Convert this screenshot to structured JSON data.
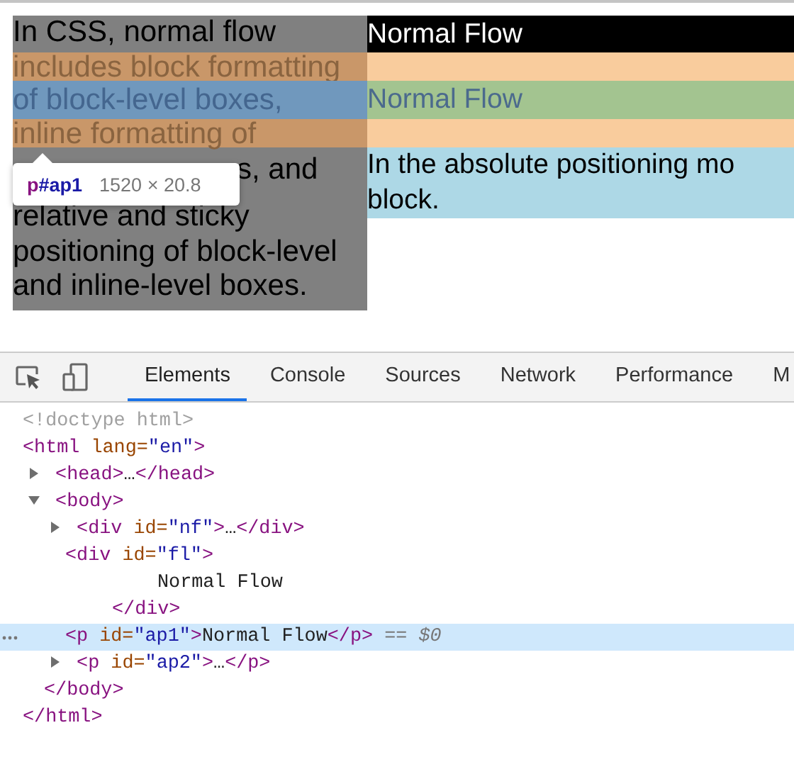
{
  "page": {
    "left_paragraph": {
      "lines": [
        {
          "text": "In CSS, normal flow",
          "kind": "plain"
        },
        {
          "text": "includes block formatting",
          "kind": "margin"
        },
        {
          "text": "of block-level boxes,",
          "kind": "content"
        },
        {
          "text": "inline formatting of",
          "kind": "margin"
        },
        {
          "text": "s, and",
          "kind": "partial"
        },
        {
          "text": "relative and sticky",
          "kind": "plain"
        },
        {
          "text": "positioning of block-level",
          "kind": "plain"
        },
        {
          "text": "and inline-level boxes.",
          "kind": "plain"
        }
      ]
    },
    "heading": "Normal Flow",
    "highlighted_text": "Normal Flow",
    "blue_paragraph": {
      "lines": [
        "In the absolute positioning mo",
        "block."
      ]
    },
    "tooltip": {
      "tag": "p",
      "id": "#ap1",
      "size": "1520 × 20.8"
    }
  },
  "devtools": {
    "tabs": [
      {
        "label": "Elements",
        "selected": true
      },
      {
        "label": "Console",
        "selected": false
      },
      {
        "label": "Sources",
        "selected": false
      },
      {
        "label": "Network",
        "selected": false
      },
      {
        "label": "Performance",
        "selected": false
      },
      {
        "label": "M",
        "selected": false
      }
    ],
    "tree": [
      {
        "kind": "doctype",
        "selected": false,
        "text": "<!doctype html>"
      },
      {
        "kind": "element",
        "selected": false,
        "open": [
          {
            "t": "<html",
            "kind": "tag"
          },
          {
            "t": " lang=",
            "kind": "attr"
          },
          {
            "t": "\"en\"",
            "kind": "value"
          },
          {
            "t": ">",
            "kind": "tag"
          }
        ],
        "children": [
          {
            "kind": "element",
            "selected": false,
            "expanded": false,
            "open": [
              {
                "t": "<head>",
                "kind": "tag"
              },
              {
                "t": "…",
                "kind": "text"
              },
              {
                "t": "</head>",
                "kind": "tag"
              }
            ]
          },
          {
            "kind": "element",
            "selected": false,
            "expanded": true,
            "open": [
              {
                "t": "<body>",
                "kind": "tag"
              }
            ],
            "children": [
              {
                "kind": "element",
                "selected": false,
                "expanded": false,
                "open": [
                  {
                    "t": "<div",
                    "kind": "tag"
                  },
                  {
                    "t": " id=",
                    "kind": "attr"
                  },
                  {
                    "t": "\"nf\"",
                    "kind": "value"
                  },
                  {
                    "t": ">",
                    "kind": "tag"
                  },
                  {
                    "t": "…",
                    "kind": "text"
                  },
                  {
                    "t": "</div>",
                    "kind": "tag"
                  }
                ]
              },
              {
                "kind": "element",
                "selected": false,
                "open": [
                  {
                    "t": "<div",
                    "kind": "tag"
                  },
                  {
                    "t": " id=",
                    "kind": "attr"
                  },
                  {
                    "t": "\"fl\"",
                    "kind": "value"
                  },
                  {
                    "t": ">",
                    "kind": "tag"
                  }
                ],
                "children": [
                  {
                    "kind": "text",
                    "selected": false,
                    "open": [
                      {
                        "t": "Normal Flow",
                        "kind": "text"
                      }
                    ]
                  }
                ],
                "close": [
                  {
                    "t": "</div>",
                    "kind": "tag"
                  }
                ]
              },
              {
                "kind": "element",
                "selected": true,
                "open": [
                  {
                    "t": "<p",
                    "kind": "tag"
                  },
                  {
                    "t": " id=",
                    "kind": "attr"
                  },
                  {
                    "t": "\"ap1\"",
                    "kind": "value"
                  },
                  {
                    "t": ">",
                    "kind": "tag"
                  },
                  {
                    "t": "Normal Flow",
                    "kind": "text"
                  },
                  {
                    "t": "</p>",
                    "kind": "tag"
                  },
                  {
                    "t": " == ",
                    "kind": "ref"
                  },
                  {
                    "t": "$0",
                    "kind": "ref"
                  }
                ]
              },
              {
                "kind": "element",
                "selected": false,
                "expanded": false,
                "open": [
                  {
                    "t": "<p",
                    "kind": "tag"
                  },
                  {
                    "t": " id=",
                    "kind": "attr"
                  },
                  {
                    "t": "\"ap2\"",
                    "kind": "value"
                  },
                  {
                    "t": ">",
                    "kind": "tag"
                  },
                  {
                    "t": "…",
                    "kind": "text"
                  },
                  {
                    "t": "</p>",
                    "kind": "tag"
                  }
                ]
              }
            ],
            "close": [
              {
                "t": "</body>",
                "kind": "tag"
              }
            ]
          }
        ],
        "close": [
          {
            "t": "</html>",
            "kind": "tag"
          }
        ]
      }
    ]
  }
}
